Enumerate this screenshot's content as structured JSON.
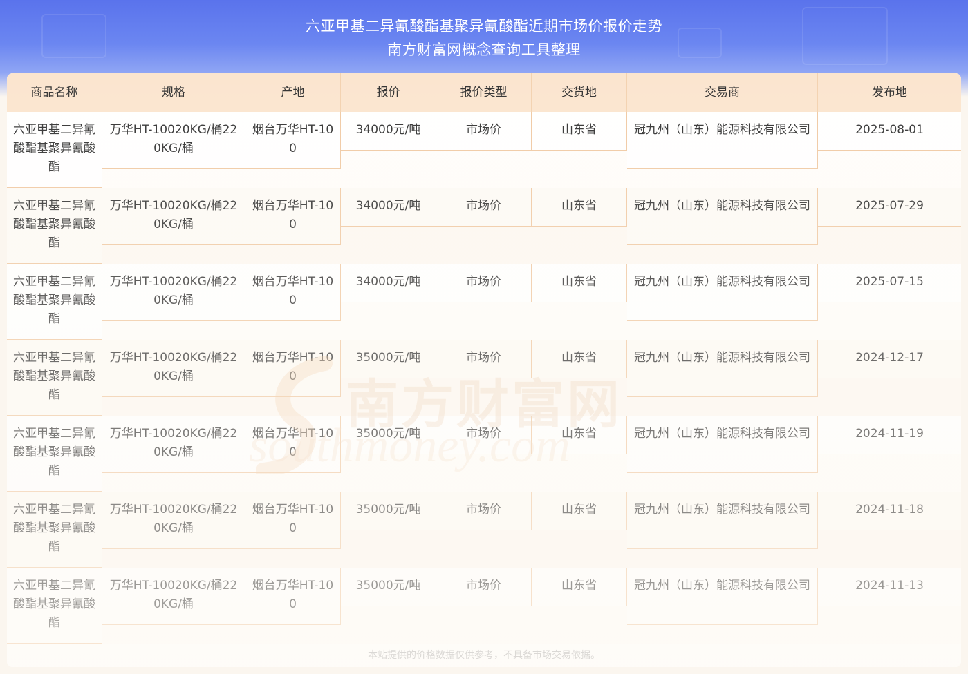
{
  "page": {
    "title_line1": "六亚甲基二异氰酸酯基聚异氰酸酯近期市场价报价走势",
    "title_line2": "南方财富网概念查询工具整理"
  },
  "table": {
    "headers": [
      "商品名称",
      "规格",
      "产地",
      "报价",
      "报价类型",
      "交货地",
      "交易商",
      "发布地"
    ],
    "rows": [
      {
        "name": "六亚甲基二异氰酸酯基聚异氰酸酯",
        "spec": "万华HT-10020KG/桶220KG/桶",
        "origin": "烟台万华HT-100",
        "price": "34000元/吨",
        "type": "市场价",
        "delivery": "山东省",
        "trader": "冠九州（山东）能源科技有限公司",
        "date": "2025-08-01"
      },
      {
        "name": "六亚甲基二异氰酸酯基聚异氰酸酯",
        "spec": "万华HT-10020KG/桶220KG/桶",
        "origin": "烟台万华HT-100",
        "price": "34000元/吨",
        "type": "市场价",
        "delivery": "山东省",
        "trader": "冠九州（山东）能源科技有限公司",
        "date": "2025-07-29"
      },
      {
        "name": "六亚甲基二异氰酸酯基聚异氰酸酯",
        "spec": "万华HT-10020KG/桶220KG/桶",
        "origin": "烟台万华HT-100",
        "price": "34000元/吨",
        "type": "市场价",
        "delivery": "山东省",
        "trader": "冠九州（山东）能源科技有限公司",
        "date": "2025-07-15"
      },
      {
        "name": "六亚甲基二异氰酸酯基聚异氰酸酯",
        "spec": "万华HT-10020KG/桶220KG/桶",
        "origin": "烟台万华HT-100",
        "price": "35000元/吨",
        "type": "市场价",
        "delivery": "山东省",
        "trader": "冠九州（山东）能源科技有限公司",
        "date": "2024-12-17"
      },
      {
        "name": "六亚甲基二异氰酸酯基聚异氰酸酯",
        "spec": "万华HT-10020KG/桶220KG/桶",
        "origin": "烟台万华HT-100",
        "price": "35000元/吨",
        "type": "市场价",
        "delivery": "山东省",
        "trader": "冠九州（山东）能源科技有限公司",
        "date": "2024-11-19"
      },
      {
        "name": "六亚甲基二异氰酸酯基聚异氰酸酯",
        "spec": "万华HT-10020KG/桶220KG/桶",
        "origin": "烟台万华HT-100",
        "price": "35000元/吨",
        "type": "市场价",
        "delivery": "山东省",
        "trader": "冠九州（山东）能源科技有限公司",
        "date": "2024-11-18"
      },
      {
        "name": "六亚甲基二异氰酸酯基聚异氰酸酯",
        "spec": "万华HT-10020KG/桶220KG/桶",
        "origin": "烟台万华HT-100",
        "price": "35000元/吨",
        "type": "市场价",
        "delivery": "山东省",
        "trader": "冠九州（山东）能源科技有限公司",
        "date": "2024-11-13"
      }
    ]
  },
  "watermark": {
    "cn": "南方财富网",
    "en": "southmoney.com"
  },
  "footer": {
    "disclaimer": "本站提供的价格数据仅供参考，不具备市场交易依据。"
  },
  "colors": {
    "header_bg": "#fbe5cf",
    "border": "#f0c9a3",
    "title_bg": "#5a73ec",
    "text": "#333333"
  }
}
